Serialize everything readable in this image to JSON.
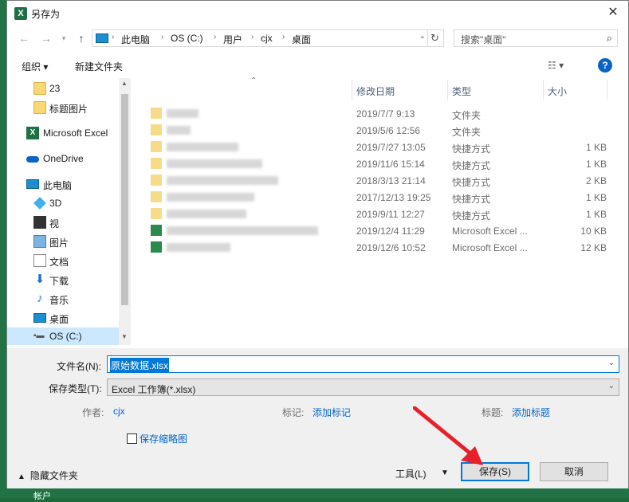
{
  "window": {
    "title": "另存为",
    "close_symbol": "✕"
  },
  "nav": {
    "breadcrumb": [
      "此电脑",
      "OS (C:)",
      "用户",
      "cjx",
      "桌面"
    ],
    "search_placeholder": "搜索\"桌面\""
  },
  "toolbar": {
    "organize": "组织 ▾",
    "new_folder": "新建文件夹"
  },
  "sidebar": {
    "items": [
      {
        "label": "23",
        "icon": "folder-icon"
      },
      {
        "label": "标题图片",
        "icon": "folder-icon"
      },
      {
        "label": "Microsoft Excel",
        "icon": "excel-icon"
      },
      {
        "label": "OneDrive",
        "icon": "onedrive-icon"
      },
      {
        "label": "此电脑",
        "icon": "pc-icon"
      },
      {
        "label": "3D",
        "icon": "3d-objects-icon"
      },
      {
        "label": "视",
        "icon": "video-icon"
      },
      {
        "label": "图片",
        "icon": "pictures-icon"
      },
      {
        "label": "文档",
        "icon": "documents-icon"
      },
      {
        "label": "下载",
        "icon": "download-icon"
      },
      {
        "label": "音乐",
        "icon": "music-icon"
      },
      {
        "label": "桌面",
        "icon": "desktop-icon"
      },
      {
        "label": "OS (C:)",
        "icon": "drive-icon"
      }
    ]
  },
  "columns": {
    "date": "修改日期",
    "type": "类型",
    "size": "大小"
  },
  "files": [
    {
      "date": "2019/7/7 9:13",
      "type": "文件夹",
      "size": ""
    },
    {
      "date": "2019/5/6 12:56",
      "type": "文件夹",
      "size": ""
    },
    {
      "date": "2019/7/27 13:05",
      "type": "快捷方式",
      "size": "1 KB"
    },
    {
      "date": "2019/11/6 15:14",
      "type": "快捷方式",
      "size": "1 KB"
    },
    {
      "date": "2018/3/13 21:14",
      "type": "快捷方式",
      "size": "2 KB"
    },
    {
      "date": "2017/12/13 19:25",
      "type": "快捷方式",
      "size": "1 KB"
    },
    {
      "date": "2019/9/11 12:27",
      "type": "快捷方式",
      "size": "1 KB"
    },
    {
      "date": "2019/12/4 11:29",
      "type": "Microsoft Excel ...",
      "size": "10 KB"
    },
    {
      "date": "2019/12/6 10:52",
      "type": "Microsoft Excel ...",
      "size": "12 KB"
    }
  ],
  "form": {
    "filename_label": "文件名(N):",
    "filename_value": "原始数据.xlsx",
    "filetype_label": "保存类型(T):",
    "filetype_value": "Excel 工作簿(*.xlsx)",
    "author_label": "作者:",
    "author_value": "cjx",
    "tags_label": "标记:",
    "tags_value": "添加标记",
    "title_label": "标题:",
    "title_value": "添加标题",
    "thumbnail_label": "保存缩略图",
    "hide_folders": "隐藏文件夹",
    "tools": "工具(L)",
    "save": "保存(S)",
    "cancel": "取消"
  },
  "background": {
    "status_text": "帐户"
  },
  "colors": {
    "accent": "#0078d7",
    "excel_green": "#217346",
    "arrow_red": "#e8202a"
  }
}
